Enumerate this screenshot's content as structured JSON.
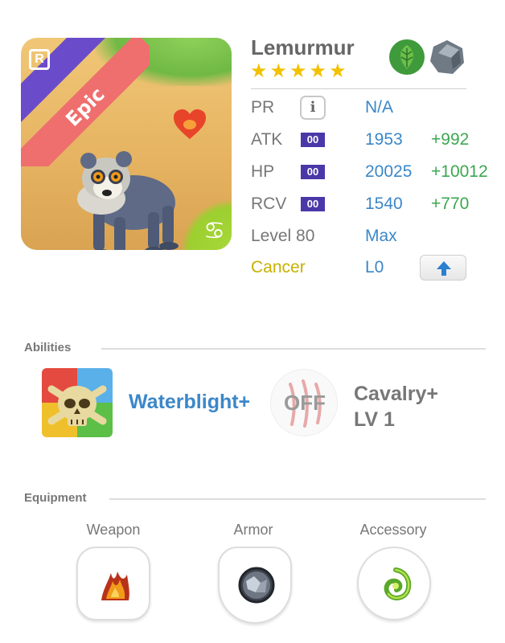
{
  "hero": {
    "name": "Lemurmur",
    "rarity": "Epic",
    "rare_badge": "R",
    "stars": 5,
    "zodiac_symbol": "♋",
    "element_icons": [
      "leaf-element-icon",
      "stone-element-icon"
    ]
  },
  "stats": {
    "pr": {
      "label": "PR",
      "value": "N/A",
      "info_label": "i"
    },
    "atk": {
      "label": "ATK",
      "chip": "00",
      "value": "1953",
      "bonus": "+992"
    },
    "hp": {
      "label": "HP",
      "chip": "00",
      "value": "20025",
      "bonus": "+10012"
    },
    "rcv": {
      "label": "RCV",
      "chip": "00",
      "value": "1540",
      "bonus": "+770"
    },
    "level": {
      "label": "Level 80",
      "value": "Max"
    },
    "sign": {
      "label": "Cancer",
      "value": "L0"
    }
  },
  "abilities": {
    "title": "Abilities",
    "active_name": "Waterblight+",
    "passive_status": "OFF",
    "passive_name_line1": "Cavalry+",
    "passive_name_line2": "LV 1"
  },
  "equipment": {
    "title": "Equipment",
    "slots": [
      {
        "label": "Weapon",
        "icon": "flame-claw-icon"
      },
      {
        "label": "Armor",
        "icon": "crystal-orb-icon"
      },
      {
        "label": "Accessory",
        "icon": "green-swirl-icon"
      }
    ]
  },
  "colors": {
    "stat_value": "#3b87c8",
    "stat_bonus": "#3ba850",
    "cancer_label": "#c8b000",
    "epic_ribbon": "#ef6e6e",
    "rare_ribbon": "#6a4bc9",
    "star": "#f2c100"
  }
}
